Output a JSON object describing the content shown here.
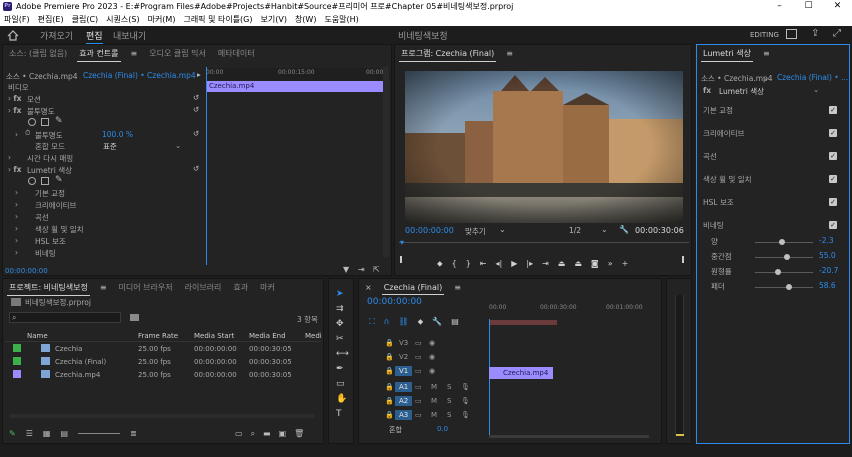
{
  "app": {
    "title": "Adobe Premiere Pro 2023 - E:#Program Files#Adobe#Projects#Hanbit#Source#프리미어 프로#Chapter 05#비네팅색보정.prproj",
    "menu": [
      "파일(F)",
      "편집(E)",
      "클립(C)",
      "시퀀스(S)",
      "마커(M)",
      "그래픽 및 타이틀(G)",
      "보기(V)",
      "창(W)",
      "도움말(H)"
    ]
  },
  "workspace": {
    "tabs": [
      "가져오기",
      "편집",
      "내보내기"
    ],
    "active_tab": "편집",
    "center_title": "비네팅색보정",
    "mode": "EDITING"
  },
  "effect_controls": {
    "tabs": [
      "소스: (클립 없음)",
      "효과 컨트롤",
      "오디오 클립 믹서",
      "메타데이터"
    ],
    "source_label": "소스 • Czechia.mp4",
    "sequence_label": "Czechia (Final) • Czechia.mp4",
    "ruler": [
      "00:00",
      "00:00:15:00",
      "00:00"
    ],
    "clip_bar": "Czechia.mp4",
    "section": "비디오",
    "rows": {
      "motion": "모션",
      "opacity": "불투명도",
      "opacity_label": "불투명도",
      "opacity_value": "100.0 %",
      "blend_label": "혼합 모드",
      "blend_value": "표준",
      "time_remap": "시간 다시 매핑",
      "lumetri": "Lumetri 색상",
      "items": [
        "기본 교정",
        "크리에이티브",
        "곡선",
        "색상 휠 및 일치",
        "HSL 보조",
        "비네팅"
      ]
    },
    "timecode": "00:00:00:00"
  },
  "program": {
    "title": "프로그램: Czechia (Final)",
    "timecode": "00:00:00:00",
    "fit": "맞추기",
    "quality": "1/2",
    "duration": "00:00:30:06"
  },
  "lumetri": {
    "title": "Lumetri 색상",
    "source_label": "소스 • Czechia.mp4",
    "sequence_label": "Czechia (Final) • ...",
    "fx_label": "Lumetri 색상",
    "sections": [
      "기본 교정",
      "크리에이티브",
      "곡선",
      "색상 휠 및 일치",
      "HSL 보조",
      "비네팅"
    ],
    "sliders": [
      {
        "label": "양",
        "value": "-2.3",
        "fraction": 0.46
      },
      {
        "label": "중간점",
        "value": "55.0",
        "fraction": 0.55
      },
      {
        "label": "원형률",
        "value": "-20.7",
        "fraction": 0.4
      },
      {
        "label": "페더",
        "value": "58.6",
        "fraction": 0.59
      }
    ]
  },
  "project": {
    "tabs": [
      "프로젝트: 비네팅색보정",
      "미디어 브라우저",
      "라이브러리",
      "효과",
      "마커"
    ],
    "file": "비네팅색보정.prproj",
    "count": "3 항목",
    "columns": [
      "Name",
      "Frame Rate",
      "Media Start",
      "Media End",
      "Medi"
    ],
    "items": [
      {
        "name": "Czechia",
        "fps": "25.00 fps",
        "start": "00:00:00:00",
        "end": "00:00:30:05",
        "color": "#3cb04a"
      },
      {
        "name": "Czechia (Final)",
        "fps": "25.00 fps",
        "start": "00:00:00:00",
        "end": "00:00:30:05",
        "color": "#3cb04a"
      },
      {
        "name": "Czechia.mp4",
        "fps": "25.00 fps",
        "start": "00:00:00:00",
        "end": "00:00:30:05",
        "color": "#9a8cff"
      }
    ]
  },
  "timeline": {
    "title": "Czechia (Final)",
    "timecode": "00:00:00:00",
    "ruler": [
      "00:00",
      "00:00:30:00",
      "00:01:00:00"
    ],
    "video_tracks": [
      "V3",
      "V2",
      "V1"
    ],
    "audio_tracks": [
      "A1",
      "A2",
      "A3"
    ],
    "clip": "Czechia.mp4",
    "master": "혼합",
    "master_value": "0.0"
  },
  "colors": {
    "accent": "#2d8ceb",
    "clip": "#9a8cff"
  }
}
